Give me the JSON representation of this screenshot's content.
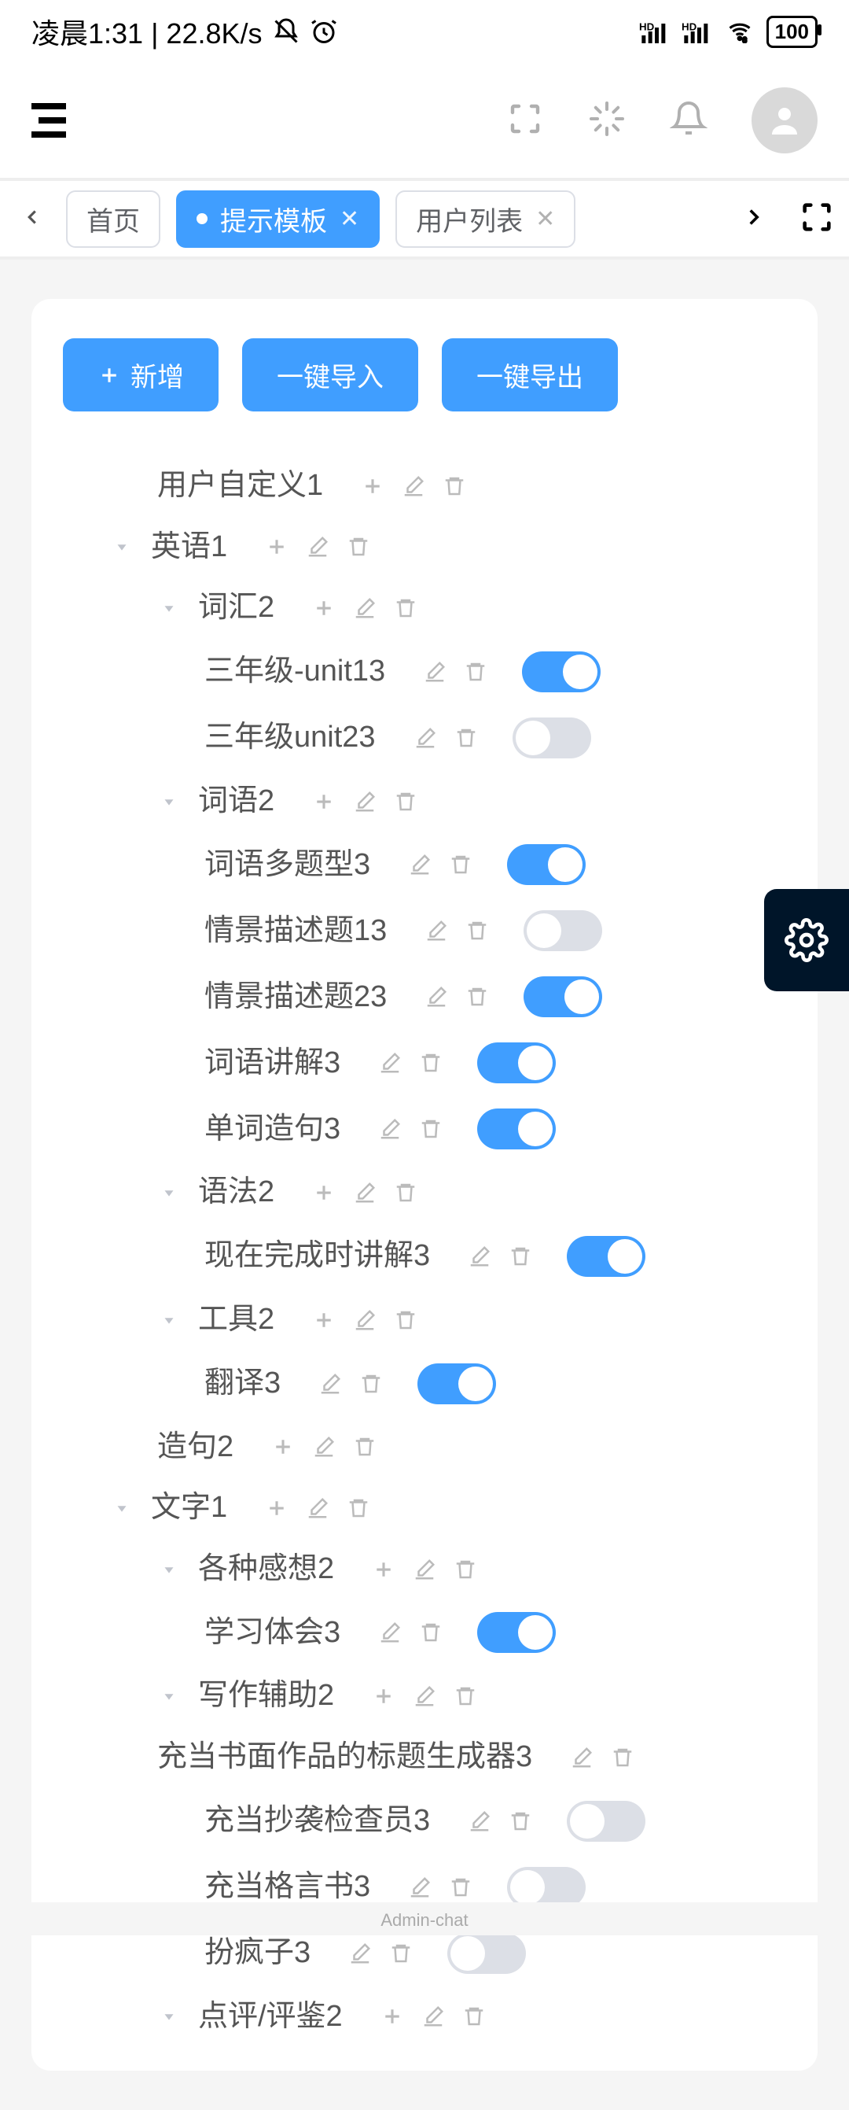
{
  "status": {
    "time_text": "凌晨1:31 | 22.8K/s",
    "battery": "100"
  },
  "tabs": {
    "home": "首页",
    "active": "提示模板",
    "users": "用户列表"
  },
  "buttons": {
    "add": "新增",
    "import": "一键导入",
    "export": "一键导出"
  },
  "tree": {
    "n0": "用户自定义1",
    "n1": "英语1",
    "n1_1": "词汇2",
    "n1_1_1": "三年级-unit13",
    "n1_1_2": "三年级unit23",
    "n1_2": "词语2",
    "n1_2_1": "词语多题型3",
    "n1_2_2": "情景描述题13",
    "n1_2_3": "情景描述题23",
    "n1_2_4": "词语讲解3",
    "n1_2_5": "单词造句3",
    "n1_3": "语法2",
    "n1_3_1": "现在完成时讲解3",
    "n1_4": "工具2",
    "n1_4_1": "翻译3",
    "n1_5": "造句2",
    "n2": "文字1",
    "n2_1": "各种感想2",
    "n2_1_1": "学习体会3",
    "n2_2": "写作辅助2",
    "n2_2_1": "充当书面作品的标题生成器3",
    "n2_2_2": "充当抄袭检查员3",
    "n2_2_3": "充当格言书3",
    "n2_2_4": "扮疯子3",
    "n2_3": "点评/评鉴2"
  },
  "switches": {
    "n1_1_1": true,
    "n1_1_2": false,
    "n1_2_1": true,
    "n1_2_2": false,
    "n1_2_3": true,
    "n1_2_4": true,
    "n1_2_5": true,
    "n1_3_1": true,
    "n1_4_1": true,
    "n2_1_1": true,
    "n2_2_2": false,
    "n2_2_3": false,
    "n2_2_4": false
  },
  "footer": "Admin-chat"
}
